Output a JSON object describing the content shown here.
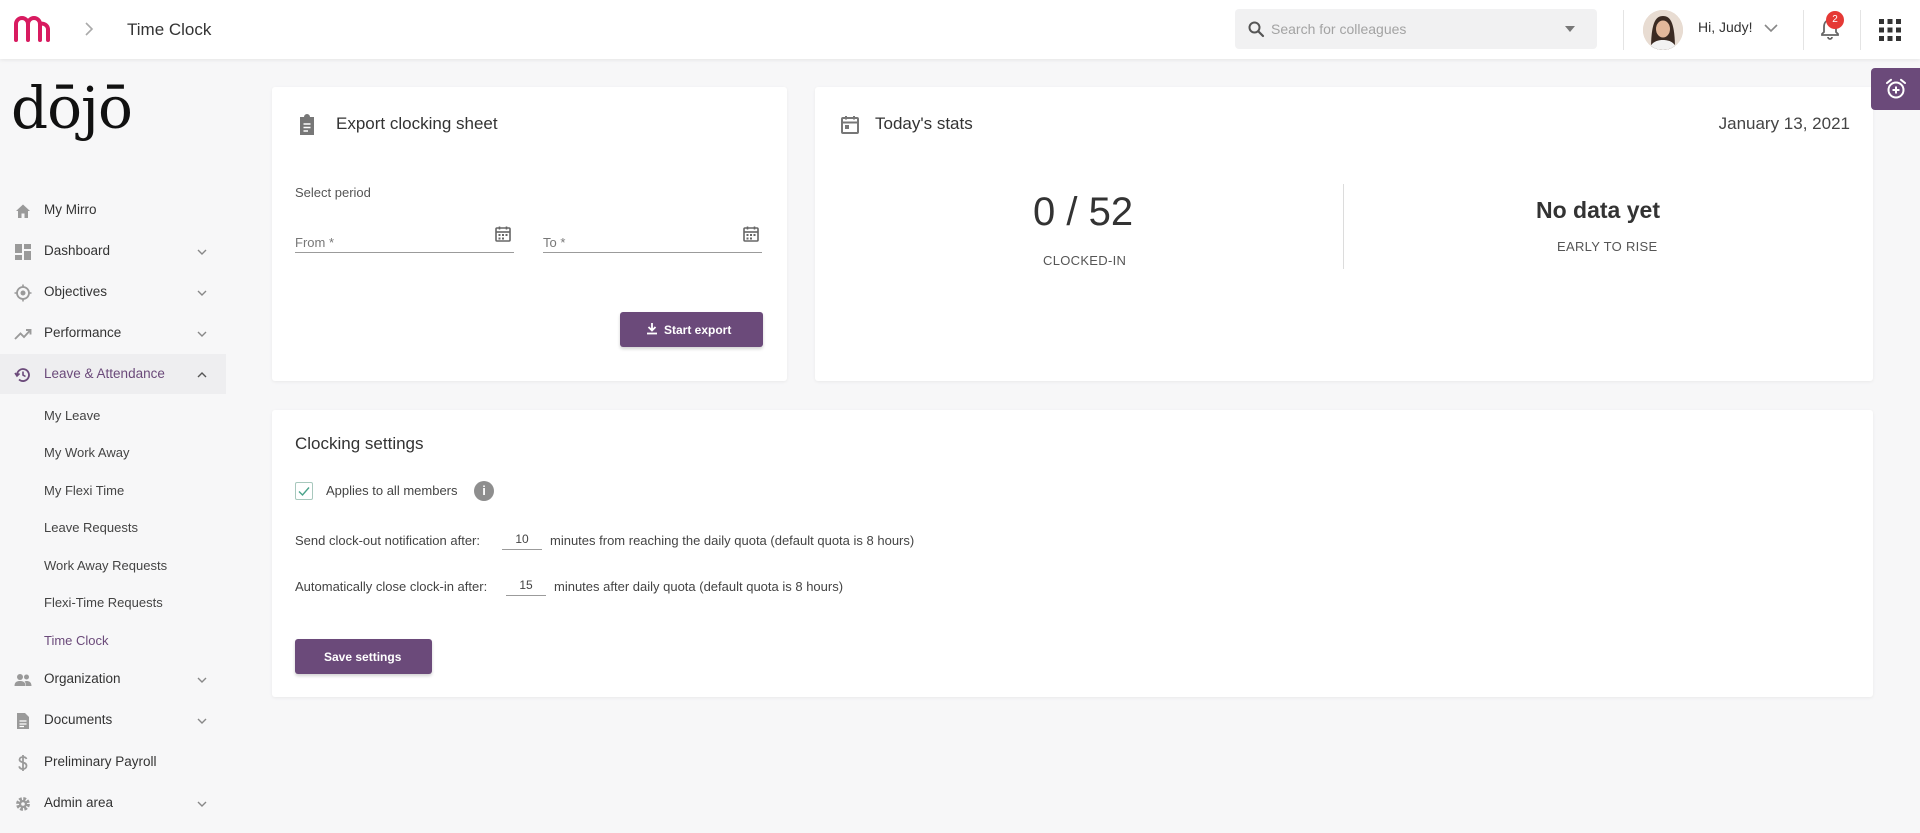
{
  "header": {
    "title": "Time Clock",
    "search_placeholder": "Search for colleagues",
    "greeting": "Hi, Judy!",
    "notifications_count": "2"
  },
  "sidebar": {
    "brand": "dōjō",
    "items": [
      {
        "label": "My Mirro",
        "icon": "home-icon"
      },
      {
        "label": "Dashboard",
        "icon": "dashboard-icon"
      },
      {
        "label": "Objectives",
        "icon": "target-icon"
      },
      {
        "label": "Performance",
        "icon": "trending-up-icon"
      },
      {
        "label": "Leave & Attendance",
        "icon": "history-icon"
      },
      {
        "label": "Organization",
        "icon": "people-icon"
      },
      {
        "label": "Documents",
        "icon": "document-icon"
      },
      {
        "label": "Preliminary Payroll",
        "icon": "dollar-icon"
      },
      {
        "label": "Admin area",
        "icon": "gear-icon"
      }
    ],
    "subitems": [
      "My Leave",
      "My Work Away",
      "My Flexi Time",
      "Leave Requests",
      "Work Away Requests",
      "Flexi-Time Requests",
      "Time Clock"
    ]
  },
  "export": {
    "title": "Export clocking sheet",
    "period_label": "Select period",
    "from_label": "From *",
    "to_label": "To *",
    "button": "Start export"
  },
  "stats": {
    "title": "Today's stats",
    "date": "January 13, 2021",
    "clocked_value": "0 / 52",
    "clocked_caption": "CLOCKED-IN",
    "early_value": "No data yet",
    "early_caption": "EARLY TO RISE"
  },
  "settings": {
    "title": "Clocking settings",
    "applies_label": "Applies to all members",
    "applies_checked": true,
    "notify_prefix": "Send clock-out notification after:",
    "notify_value": "10",
    "notify_suffix": "minutes from reaching the daily quota (default quota is 8 hours)",
    "close_prefix": "Automatically close clock-in after:",
    "close_value": "15",
    "close_suffix": "minutes after daily quota (default quota is 8 hours)",
    "save_button": "Save settings"
  },
  "colors": {
    "accent": "#6b4a7a",
    "brand_logo": "#d81b60",
    "badge": "#e53935"
  }
}
